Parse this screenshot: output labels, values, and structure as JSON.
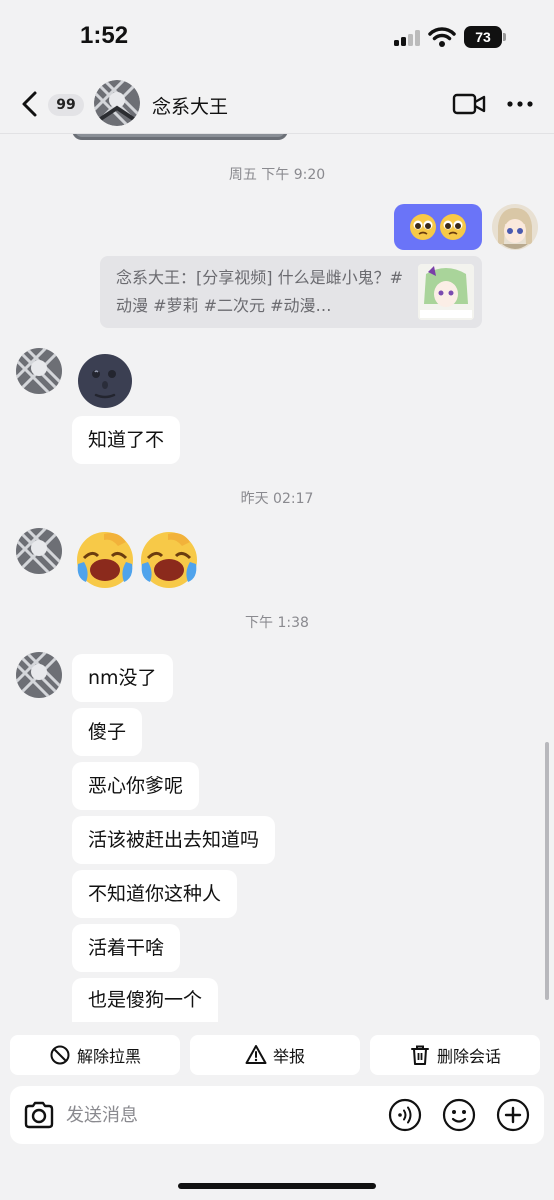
{
  "status_bar": {
    "time": "1:52",
    "battery": "73"
  },
  "header": {
    "unread_count": "99",
    "contact_name": "念系大王"
  },
  "messages": {
    "ts1": "周五 下午 9:20",
    "share_card_text": "念系大王：[分享视频] 什么是雌小鬼？#动漫 #萝莉 #二次元 #动漫…",
    "text1": "知道了不",
    "ts2": "昨天 02:17",
    "ts3": "下午 1:38",
    "t_nm": "nm没了",
    "t_sha": "傻子",
    "t_exin": "恶心你爹呢",
    "t_huogai": "活该被赶出去知道吗",
    "t_buzhidao": "不知道你这种人",
    "t_huozhe": "活着干啥",
    "t_yeshi": "也是傻狗一个"
  },
  "actions": {
    "unblock": "解除拉黑",
    "report": "举报",
    "delete_chat": "删除会话"
  },
  "input": {
    "placeholder": "发送消息"
  },
  "colors": {
    "my_bubble": "#6a74f8",
    "background": "#f2f2f3"
  }
}
